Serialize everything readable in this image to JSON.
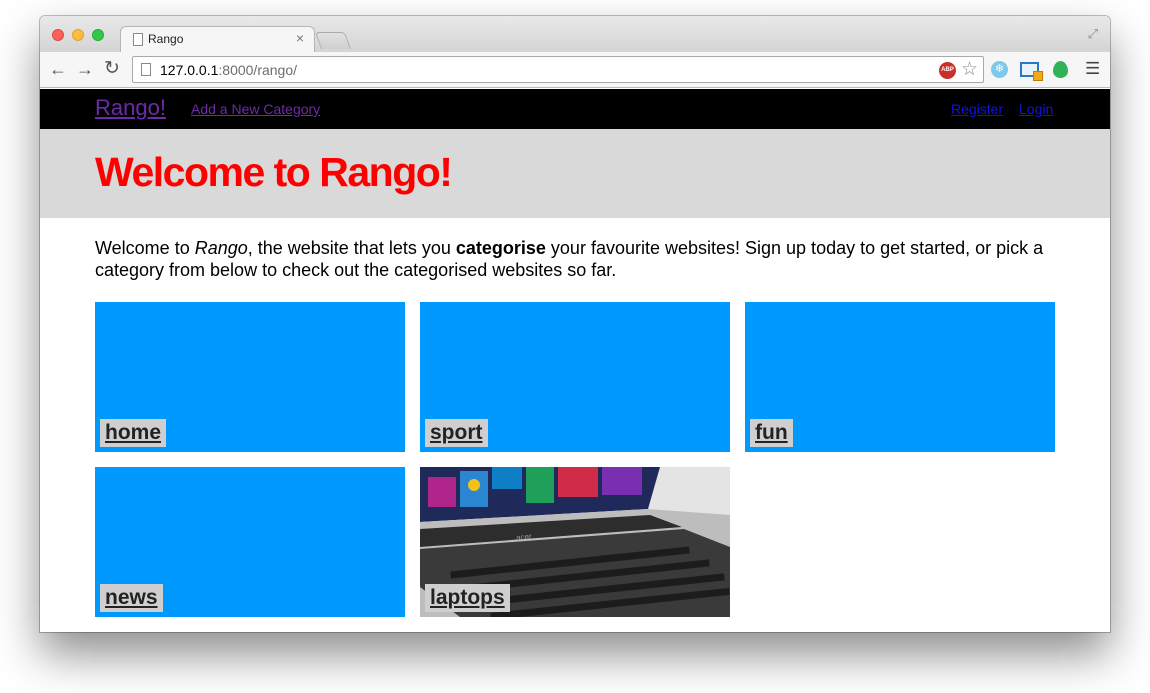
{
  "browser": {
    "tab_title": "Rango",
    "tab_close": "×",
    "url_host": "127.0.0.1",
    "url_rest": ":8000/rango/",
    "abp_label": "ABP"
  },
  "nav": {
    "brand": "Rango!",
    "add_category": "Add a New Category",
    "register": "Register",
    "login": "Login"
  },
  "hero": {
    "title": "Welcome to Rango!"
  },
  "intro": {
    "prefix": "Welcome to ",
    "rango": "Rango",
    "middle": ", the website that lets you ",
    "categorise": "categorise",
    "suffix": " your favourite websites! Sign up today to get started, or pick a category from below to check out the categorised websites so far."
  },
  "categories": [
    {
      "label": "home"
    },
    {
      "label": "sport"
    },
    {
      "label": "fun"
    },
    {
      "label": "news"
    },
    {
      "label": "laptops"
    }
  ],
  "colors": {
    "tile_blue": "#0099ff",
    "hero_bg": "#d9d9d9",
    "title_red": "#ff0000",
    "navbar_bg": "#000000"
  }
}
